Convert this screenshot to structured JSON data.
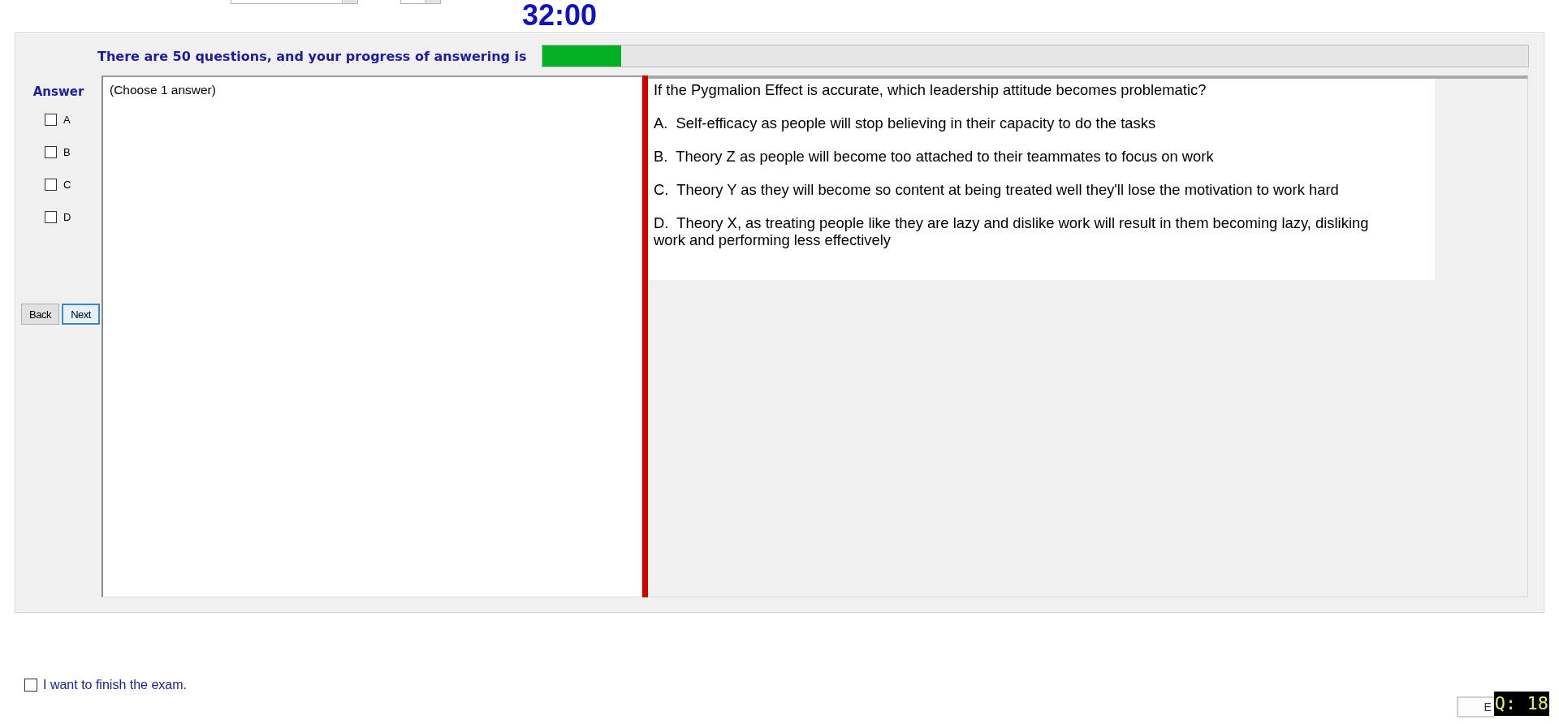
{
  "top_bar": {
    "timer": "32:00"
  },
  "progress": {
    "label": "There are 50 questions, and your progress of answering is",
    "level": 0.08
  },
  "answer_panel": {
    "title": "Answer",
    "options": [
      {
        "label": "A",
        "checked": false
      },
      {
        "label": "B",
        "checked": false
      },
      {
        "label": "C",
        "checked": false
      },
      {
        "label": "D",
        "checked": false
      }
    ],
    "buttons": [
      {
        "label": "Back",
        "focused": false
      },
      {
        "label": "Next",
        "focused": true
      }
    ]
  },
  "answer_box": {
    "text": "(Choose 1 answer)"
  },
  "question": {
    "text": "If the Pygmalion Effect is accurate, which leadership attitude becomes problematic?",
    "options": [
      "A.  Self-efficacy as people will stop believing in their capacity to do the tasks",
      "B.  Theory Z as people will become too attached to their teammates to focus on work",
      "C.  Theory Y as they will become so content at being treated well they'll lose the motivation to work hard",
      "D.  Theory X, as treating people like they are lazy and dislike work will result in them becoming lazy, disliking work and performing less effectively"
    ]
  },
  "finish": {
    "label": "I want to finish the exam.",
    "checked": false
  },
  "footer": {
    "exit_button": {
      "kind": "exit",
      "label": "E"
    },
    "question_badge": "Q: 18"
  }
}
